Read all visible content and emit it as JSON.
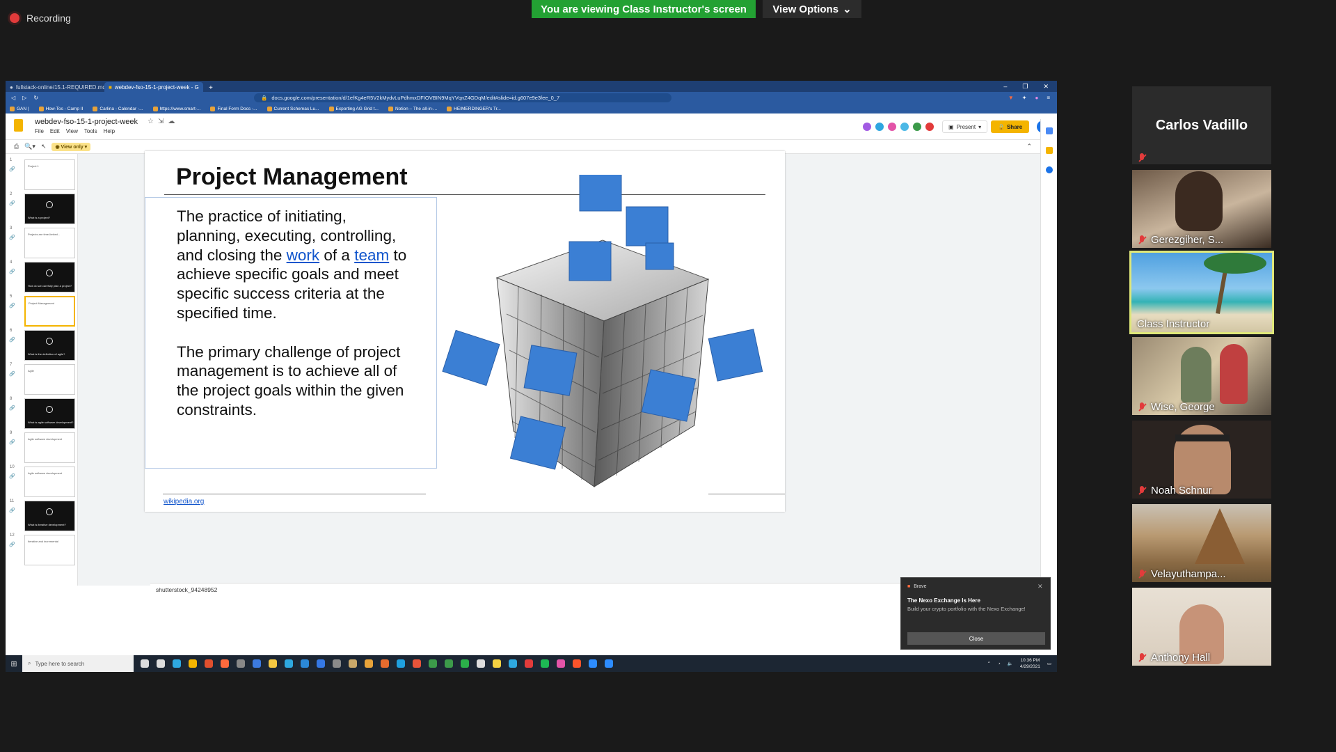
{
  "recording": {
    "label": "Recording"
  },
  "banner": {
    "viewing": "You are viewing Class Instructor's screen",
    "view_options": "View Options"
  },
  "browser": {
    "tabs": [
      {
        "label": "fullstack-online/15.1-REQUIRED.md at"
      },
      {
        "label": "webdev-fso-15-1-project-week - G"
      }
    ],
    "url": "docs.google.com/presentation/d/1efKg4eR5V2kMydvLuPdhmxDFIOVBIN9MqYVqnZ4GDqM/edit#slide=id.g607e9e3fee_0_7",
    "bookmarks": [
      "GAN |",
      "How-Tos - Camp II",
      "Carlina - Calendar -...",
      "https://www.smart-...",
      "Final Form Docs -...",
      "Current Schemas Lu...",
      "Exporting AG Grid t...",
      "Notion – The all-in-...",
      "HEIMERDINGER's Tr..."
    ]
  },
  "docs": {
    "title": "webdev-fso-15-1-project-week",
    "menu": [
      "File",
      "Edit",
      "View",
      "Tools",
      "Help"
    ],
    "present": "Present",
    "share": "Share",
    "user_initial": "E",
    "view_only": "View only"
  },
  "filmstrip": [
    {
      "num": "1",
      "text": "Project 1",
      "dark": false
    },
    {
      "num": "2",
      "text": "What is a project?",
      "dark": true
    },
    {
      "num": "3",
      "text": "Projects are time-limited...",
      "dark": false
    },
    {
      "num": "4",
      "text": "How do we carefully plan a project?",
      "dark": true
    },
    {
      "num": "5",
      "text": "Project Management",
      "dark": false,
      "selected": true
    },
    {
      "num": "6",
      "text": "What is the definition of agile?",
      "dark": true
    },
    {
      "num": "7",
      "text": "Agile",
      "dark": false
    },
    {
      "num": "8",
      "text": "What is agile software development?",
      "dark": true
    },
    {
      "num": "9",
      "text": "Agile software development",
      "dark": false
    },
    {
      "num": "10",
      "text": "Agile software development",
      "dark": false
    },
    {
      "num": "11",
      "text": "What is iterative development?",
      "dark": true
    },
    {
      "num": "12",
      "text": "Iterative and incremental",
      "dark": false
    }
  ],
  "slide": {
    "title": "Project Management",
    "p1_a": "The practice of initiating, planning, executing, controlling, and closing the ",
    "p1_link1": "work",
    "p1_b": " of a ",
    "p1_link2": "team",
    "p1_c": " to achieve specific goals and meet specific success criteria at the specified time.",
    "p2": "The primary challenge of project management is to achieve all of the project goals within the given constraints.",
    "source": "wikipedia.org"
  },
  "notes": "shutterstock_94248952",
  "taskbar": {
    "search": "Type here to search",
    "time": "10:36 PM",
    "date": "4/29/2021"
  },
  "toast": {
    "app": "Brave",
    "title": "The Nexo Exchange Is Here",
    "body": "Build your crypto portfolio with the Nexo Exchange!",
    "button": "Close"
  },
  "participants": [
    {
      "name": "Carlos Vadillo",
      "video": false
    },
    {
      "name": "Gerezgiher, S...",
      "video": true
    },
    {
      "name": "Class Instructor",
      "video": true,
      "active": true
    },
    {
      "name": "Wise, George",
      "video": true
    },
    {
      "name": "Noah Schnur",
      "video": true
    },
    {
      "name": "Velayuthampa...",
      "video": true
    },
    {
      "name": "Anthony Hall",
      "video": true
    }
  ],
  "colors": {
    "banner_green": "#23a133",
    "browser_blue": "#2b5aa0",
    "slides_yellow": "#f4b400",
    "cube_blue": "#3b7fd4",
    "mute_red": "#e23b3b",
    "active_border": "#dfe77a"
  }
}
